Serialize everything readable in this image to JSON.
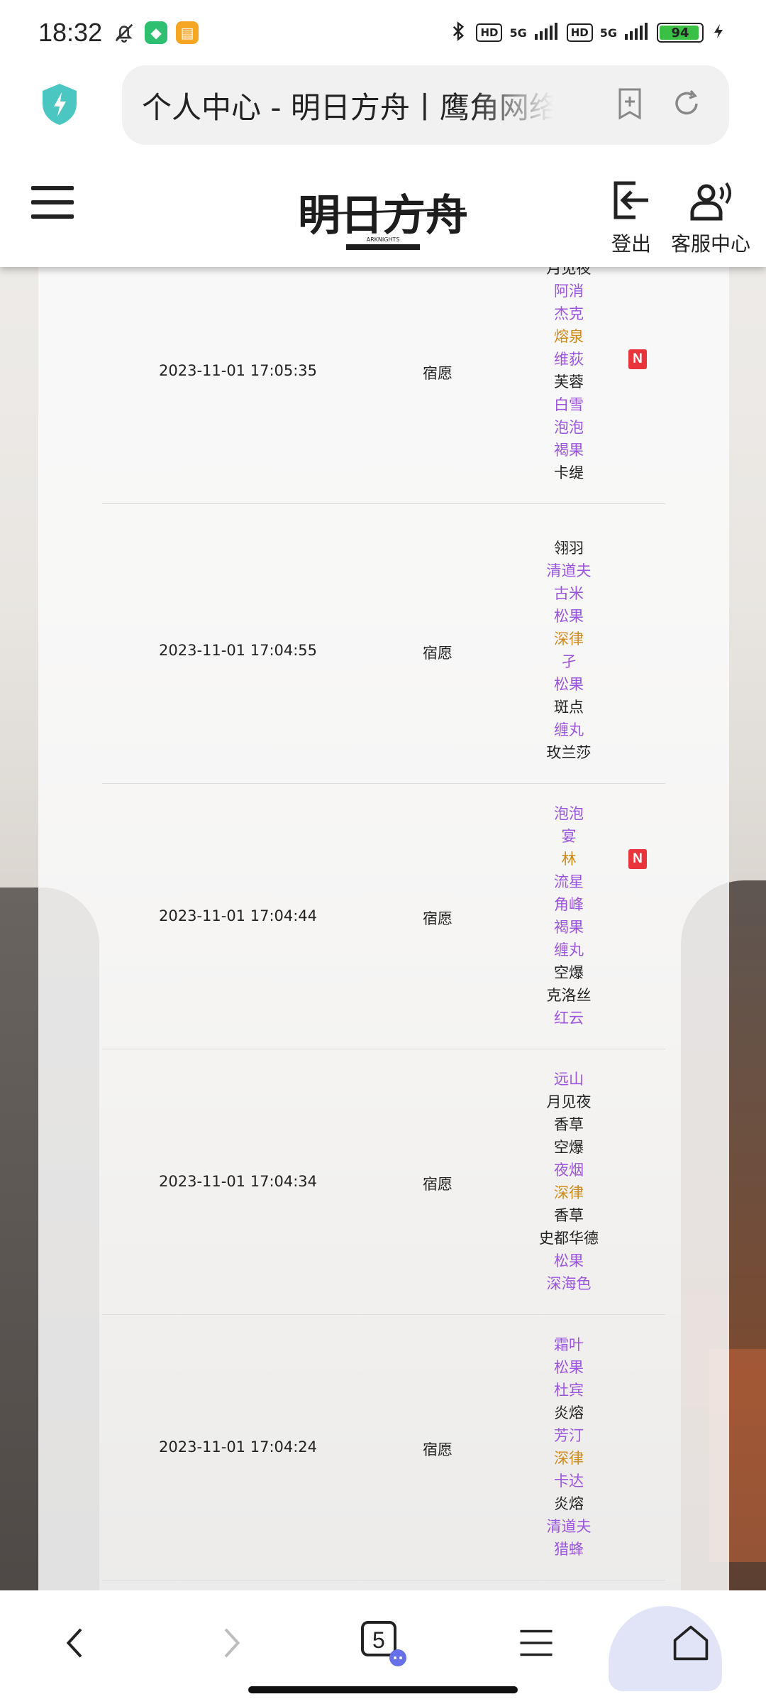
{
  "status_bar": {
    "time": "18:32",
    "battery": "94",
    "network_pills": [
      "HD",
      "HD"
    ],
    "signal_labels": [
      "5G",
      "5G"
    ],
    "icons": [
      "bell-off-icon",
      "shield-app-icon",
      "message-app-icon",
      "bluetooth-icon",
      "signal-icon",
      "charging-icon"
    ]
  },
  "address_bar": {
    "url_title": "个人中心 - 明日方舟丨鹰角网络",
    "icons": [
      "security-shield-icon",
      "add-bookmark-icon",
      "refresh-icon"
    ]
  },
  "site_header": {
    "logout_label": "登出",
    "support_label": "客服中心",
    "logo_text": "明日方舟",
    "logo_sub": "ARKNIGHTS"
  },
  "colors": {
    "rarity6": "#d08b1a",
    "rarity5": "#a565d8",
    "rarity4": "#9b55e0",
    "rarity3": "#222222",
    "new_badge": "#e8343a"
  },
  "records": [
    {
      "time": "2023-11-01 17:05:35",
      "pool": "宿愿",
      "new_index": 4,
      "new_label": "N",
      "ops": [
        {
          "name": "月见夜",
          "rarity": 3
        },
        {
          "name": "阿消",
          "rarity": 4
        },
        {
          "name": "杰克",
          "rarity": 4
        },
        {
          "name": "熔泉",
          "rarity": 6
        },
        {
          "name": "维荻",
          "rarity": 4
        },
        {
          "name": "芙蓉",
          "rarity": 3
        },
        {
          "name": "白雪",
          "rarity": 4
        },
        {
          "name": "泡泡",
          "rarity": 4
        },
        {
          "name": "褐果",
          "rarity": 4
        },
        {
          "name": "卡缇",
          "rarity": 3
        }
      ]
    },
    {
      "time": "2023-11-01 17:04:55",
      "pool": "宿愿",
      "new_index": -1,
      "new_label": "",
      "ops": [
        {
          "name": "翎羽",
          "rarity": 3
        },
        {
          "name": "清道夫",
          "rarity": 4
        },
        {
          "name": "古米",
          "rarity": 4
        },
        {
          "name": "松果",
          "rarity": 4
        },
        {
          "name": "深律",
          "rarity": 6
        },
        {
          "name": "孑",
          "rarity": 4
        },
        {
          "name": "松果",
          "rarity": 4
        },
        {
          "name": "斑点",
          "rarity": 3
        },
        {
          "name": "缠丸",
          "rarity": 4
        },
        {
          "name": "玫兰莎",
          "rarity": 3
        }
      ]
    },
    {
      "time": "2023-11-01 17:04:44",
      "pool": "宿愿",
      "new_index": 2,
      "new_label": "N",
      "ops": [
        {
          "name": "泡泡",
          "rarity": 4
        },
        {
          "name": "宴",
          "rarity": 4
        },
        {
          "name": "林",
          "rarity": 6
        },
        {
          "name": "流星",
          "rarity": 4
        },
        {
          "name": "角峰",
          "rarity": 4
        },
        {
          "name": "褐果",
          "rarity": 4
        },
        {
          "name": "缠丸",
          "rarity": 4
        },
        {
          "name": "空爆",
          "rarity": 3
        },
        {
          "name": "克洛丝",
          "rarity": 3
        },
        {
          "name": "红云",
          "rarity": 4
        }
      ]
    },
    {
      "time": "2023-11-01 17:04:34",
      "pool": "宿愿",
      "new_index": -1,
      "new_label": "",
      "ops": [
        {
          "name": "远山",
          "rarity": 4
        },
        {
          "name": "月见夜",
          "rarity": 3
        },
        {
          "name": "香草",
          "rarity": 3
        },
        {
          "name": "空爆",
          "rarity": 3
        },
        {
          "name": "夜烟",
          "rarity": 4
        },
        {
          "name": "深律",
          "rarity": 6
        },
        {
          "name": "香草",
          "rarity": 3
        },
        {
          "name": "史都华德",
          "rarity": 3
        },
        {
          "name": "松果",
          "rarity": 4
        },
        {
          "name": "深海色",
          "rarity": 4
        }
      ]
    },
    {
      "time": "2023-11-01 17:04:24",
      "pool": "宿愿",
      "new_index": -1,
      "new_label": "",
      "ops": [
        {
          "name": "霜叶",
          "rarity": 4
        },
        {
          "name": "松果",
          "rarity": 4
        },
        {
          "name": "杜宾",
          "rarity": 4
        },
        {
          "name": "炎熔",
          "rarity": 3
        },
        {
          "name": "芳汀",
          "rarity": 4
        },
        {
          "name": "深律",
          "rarity": 6
        },
        {
          "name": "卡达",
          "rarity": 4
        },
        {
          "name": "炎熔",
          "rarity": 3
        },
        {
          "name": "清道夫",
          "rarity": 4
        },
        {
          "name": "猎蜂",
          "rarity": 4
        }
      ]
    }
  ],
  "bottom_nav": {
    "tab_count": "5",
    "icons": [
      "back-icon",
      "forward-icon",
      "tabs-icon",
      "menu-icon",
      "home-icon"
    ]
  }
}
